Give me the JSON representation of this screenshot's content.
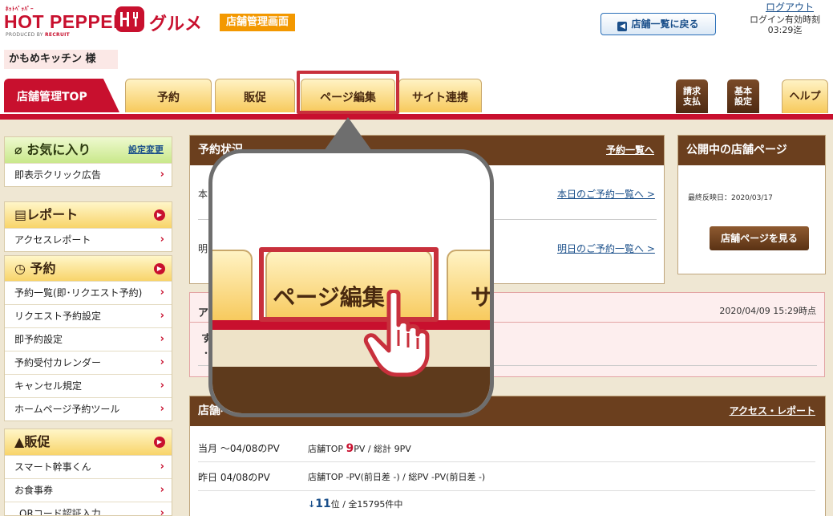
{
  "header": {
    "brand_small": "ﾎｯﾄﾍﾟｯﾊﾟｰ",
    "brand_name": "HOT PEPPER",
    "brand_sub_prefix": "PRODUCED BY ",
    "brand_sub_company": "RECRUIT",
    "logo_gurume": "グルメ",
    "admin_badge": "店舗管理画面",
    "shop_name": "かもめキッチン 様",
    "back_button": "店舗一覧に戻る",
    "logout": "ログアウト",
    "login_limit_label": "ログイン有効時刻",
    "login_limit_time": "03:29迄"
  },
  "tabs": {
    "top": "店舗管理TOP",
    "reserve": "予約",
    "promo": "販促",
    "page_edit": "ページ編集",
    "site_link": "サイト連携",
    "billing_1": "請求",
    "billing_2": "支払",
    "basic_1": "基本",
    "basic_2": "設定",
    "help": "ヘルプ"
  },
  "sidebar": {
    "favorites": {
      "title": "お気に入り",
      "setting_link": "設定変更",
      "items": [
        "即表示クリック広告"
      ]
    },
    "report": {
      "title": "レポート",
      "items": [
        "アクセスレポート"
      ]
    },
    "reserve": {
      "title": "予約",
      "items": [
        "予約一覧(即･リクエスト予約)",
        "リクエスト予約設定",
        "即予約設定",
        "予約受付カレンダー",
        "キャンセル規定",
        "ホームページ予約ツール"
      ]
    },
    "promo": {
      "title": "販促",
      "items": [
        "スマート幹事くん",
        "お食事券",
        "QRコード認証入力"
      ]
    }
  },
  "reservation_panel": {
    "title": "予約状況",
    "list_link": "予約一覧へ",
    "today_prefix": "本",
    "today_link": "本日のご予約一覧へ >",
    "tomorrow_prefix": "明",
    "tomorrow_link": "明日のご予約一覧へ >"
  },
  "public_panel": {
    "title": "公開中の店舗ページ",
    "last_reflect": "最終反映日：2020/03/17",
    "view_button": "店舗ページを見る"
  },
  "alert": {
    "prefix": "ア",
    "time": "2020/04/09 15:29時点",
    "line1": "す",
    "line2": "・"
  },
  "pv_panel": {
    "title": "店舗ペ",
    "report_link": "アクセス・レポート",
    "row1_label": "当月 ～04/08のPV",
    "row1_val_a": "店舗TOP ",
    "row1_val_num": "9",
    "row1_val_b": "PV / 総計 9PV",
    "row2_label": "昨日 04/08のPV",
    "row2_val": "店舗TOP -PV(前日差 -) / 総PV -PV(前日差 -)",
    "row3_arrow": "↓",
    "row3_rank": "11",
    "row3_val": "位 / 全15795件中"
  },
  "callout": {
    "tab_label": "ページ編集",
    "next_tab_fragment": "サ"
  }
}
